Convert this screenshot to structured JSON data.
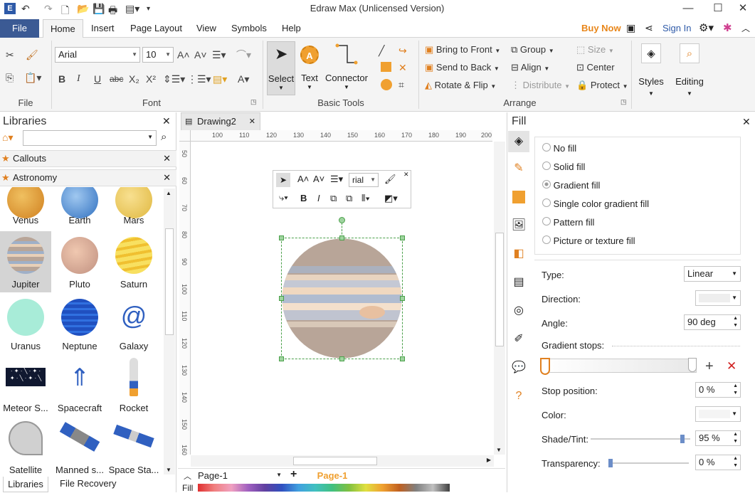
{
  "window": {
    "title": "Edraw Max (Unlicensed Version)"
  },
  "menu_tabs": [
    "File",
    "Home",
    "Insert",
    "Page Layout",
    "View",
    "Symbols",
    "Help"
  ],
  "top_right": {
    "buy_now": "Buy Now",
    "sign_in": "Sign In"
  },
  "ribbon": {
    "file_group": "File",
    "font_group": "Font",
    "font_name": "Arial",
    "font_size": "10",
    "basic_tools_group": "Basic Tools",
    "select_label": "Select",
    "text_label": "Text",
    "connector_label": "Connector",
    "arrange_group": "Arrange",
    "bring_to_front": "Bring to Front",
    "send_to_back": "Send to Back",
    "rotate_flip": "Rotate & Flip",
    "group": "Group",
    "align": "Align",
    "distribute": "Distribute",
    "size": "Size",
    "center": "Center",
    "protect": "Protect",
    "styles": "Styles",
    "editing": "Editing"
  },
  "libraries": {
    "title": "Libraries",
    "categories": [
      "Callouts",
      "Astronomy"
    ],
    "shapes": [
      {
        "label": "Venus"
      },
      {
        "label": "Earth"
      },
      {
        "label": "Mars"
      },
      {
        "label": "Jupiter"
      },
      {
        "label": "Pluto"
      },
      {
        "label": "Saturn"
      },
      {
        "label": "Uranus"
      },
      {
        "label": "Neptune"
      },
      {
        "label": "Galaxy"
      },
      {
        "label": "Meteor S..."
      },
      {
        "label": "Spacecraft"
      },
      {
        "label": "Rocket"
      },
      {
        "label": "Satellite"
      },
      {
        "label": "Manned s..."
      },
      {
        "label": "Space Sta..."
      }
    ],
    "bottom_tab": "Libraries",
    "file_recovery": "File Recovery"
  },
  "document": {
    "tab": "Drawing2",
    "ruler_h": [
      "100",
      "110",
      "120",
      "130",
      "140",
      "150",
      "160",
      "170",
      "180",
      "190",
      "200"
    ],
    "ruler_v": [
      "50",
      "60",
      "70",
      "80",
      "90",
      "100",
      "110",
      "120",
      "130",
      "140",
      "150",
      "160"
    ],
    "page_select": "Page-1",
    "page_tab": "Page-1",
    "fill_label": "Fill",
    "float_font": "rial"
  },
  "fill_panel": {
    "title": "Fill",
    "options": [
      "No fill",
      "Solid fill",
      "Gradient fill",
      "Single color gradient fill",
      "Pattern fill",
      "Picture or texture fill"
    ],
    "selected": "Gradient fill",
    "type_label": "Type:",
    "type_value": "Linear",
    "direction_label": "Direction:",
    "angle_label": "Angle:",
    "angle_value": "90 deg",
    "stops_label": "Gradient stops:",
    "stop_position_label": "Stop position:",
    "stop_position_value": "0 %",
    "color_label": "Color:",
    "shade_label": "Shade/Tint:",
    "shade_value": "95 %",
    "transparency_label": "Transparency:",
    "transparency_value": "0 %"
  },
  "colors": {
    "file_tab": "#3b5a94",
    "buy_now": "#e8861a",
    "page_tab": "#f0a030",
    "jupiter_base": "#b8a598"
  }
}
